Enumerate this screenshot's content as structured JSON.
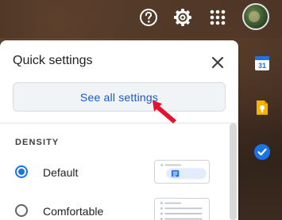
{
  "header": {
    "icons": [
      "help-icon",
      "settings-gear-icon",
      "apps-grid-icon"
    ],
    "avatar": "account-avatar"
  },
  "quick_settings": {
    "title": "Quick settings",
    "see_all_label": "See all settings",
    "density": {
      "section_label": "DENSITY",
      "options": [
        {
          "label": "Default",
          "selected": true
        },
        {
          "label": "Comfortable",
          "selected": false
        }
      ]
    }
  },
  "side_panel": {
    "apps": [
      {
        "icon": "calendar-icon",
        "text": "31",
        "color": "#1a73e8"
      },
      {
        "icon": "keep-icon",
        "color": "#f5b400"
      },
      {
        "icon": "tasks-icon",
        "color": "#1a73e8"
      }
    ]
  },
  "colors": {
    "accent": "#1a73e8",
    "link_text": "#1a57c4",
    "annotation_arrow": "#e8112d"
  }
}
